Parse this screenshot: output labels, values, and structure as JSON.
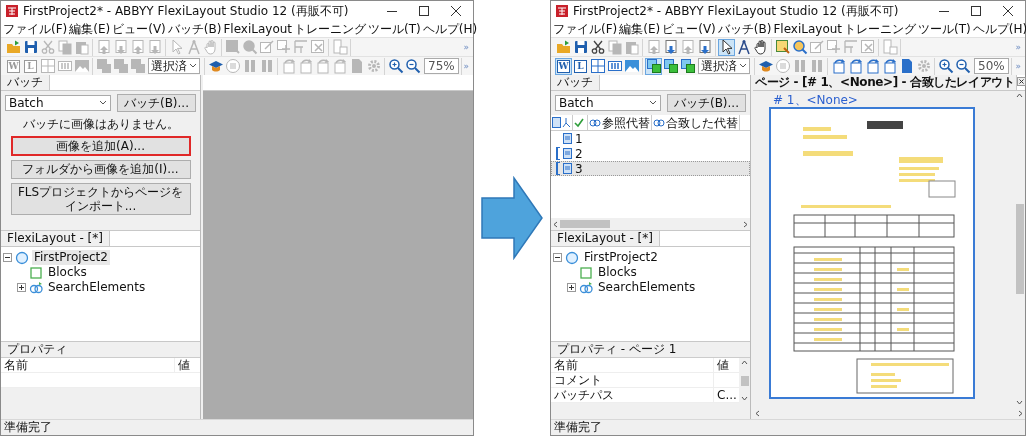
{
  "windows": [
    {
      "title": "FirstProject2* - ABBYY FlexiLayout Studio 12 (再販不可)",
      "menu": [
        "ファイル(F)",
        "編集(E)",
        "ビュー(V)",
        "バッチ(B)",
        "FlexiLayout",
        "トレーニング",
        "ツール(T)",
        "ヘルプ(H)"
      ],
      "toolbars": [
        {
          "groups": [
            [
              {
                "selected": false,
                "disabled": false
              },
              {
                "selected": false,
                "disabled": false
              },
              {
                "selected": false,
                "disabled": true
              },
              {
                "selected": false,
                "disabled": true
              },
              {
                "selected": false,
                "disabled": true
              }
            ],
            [
              {
                "selected": false,
                "disabled": true
              },
              {
                "selected": false,
                "disabled": true
              },
              {
                "selected": false,
                "disabled": true
              },
              {
                "selected": false,
                "disabled": true
              }
            ],
            [
              {
                "selected": false,
                "disabled": true
              },
              {
                "selected": false,
                "disabled": true
              },
              {
                "selected": false,
                "disabled": true
              }
            ],
            [
              {
                "selected": false,
                "disabled": true
              },
              {
                "selected": false,
                "disabled": true
              },
              {
                "selected": false,
                "disabled": true
              },
              {
                "selected": false,
                "disabled": true
              },
              {
                "selected": false,
                "disabled": true
              },
              {
                "selected": false,
                "disabled": true
              }
            ],
            [
              {
                "selected": false,
                "disabled": true
              }
            ]
          ],
          "overflow": "»"
        },
        {
          "groups": [
            [
              {
                "label": "W",
                "selected": false,
                "disabled": true
              },
              {
                "label": "L",
                "selected": false,
                "disabled": true
              },
              {
                "selected": false,
                "disabled": true
              },
              {
                "selected": false,
                "disabled": true
              },
              {
                "selected": false,
                "disabled": true
              }
            ],
            [
              {
                "selected": false,
                "disabled": true
              },
              {
                "selected": false,
                "disabled": true
              },
              {
                "selected": false,
                "disabled": true
              }
            ],
            [
              {
                "selected": false,
                "disabled": false
              },
              {
                "selected": false,
                "disabled": true
              },
              {
                "selected": false,
                "disabled": true
              },
              {
                "selected": false,
                "disabled": true
              }
            ],
            [
              {
                "selected": false,
                "disabled": true
              },
              {
                "selected": false,
                "disabled": true
              },
              {
                "selected": false,
                "disabled": true
              },
              {
                "selected": false,
                "disabled": true
              },
              {
                "selected": false,
                "disabled": true
              },
              {
                "selected": false,
                "disabled": true
              }
            ],
            [
              {
                "selected": false,
                "disabled": false
              },
              {
                "selected": false,
                "disabled": false
              }
            ]
          ],
          "overflow": "»"
        }
      ],
      "selection_filter": "選択済",
      "zoom": "75%",
      "batch": {
        "tab": "バッチ",
        "dropdown": "Batch",
        "button": "バッチ(B)...",
        "message": "バッチに画像はありません。",
        "actions": [
          {
            "label": "画像を追加(A)...",
            "highlighted": true
          },
          {
            "label": "フォルダから画像を追加(I)...",
            "highlighted": false
          },
          {
            "label": "FLSプロジェクトからページをインポート...",
            "highlighted": false
          }
        ]
      },
      "layout_tab": "FlexiLayout - [*]",
      "tree": [
        {
          "label": "FirstProject2",
          "kind": "project",
          "expanded": true,
          "selected": true,
          "children": [
            {
              "label": "Blocks",
              "kind": "blocks",
              "selected": false
            },
            {
              "label": "SearchElements",
              "kind": "search",
              "expanded": false,
              "selected": false
            }
          ]
        }
      ],
      "properties": {
        "title": "プロパティ",
        "columns": [
          "名前",
          "値"
        ]
      },
      "status": "準備完了"
    },
    {
      "title": "FirstProject2* - ABBYY FlexiLayout Studio 12 (再販不可)",
      "menu": [
        "ファイル(F)",
        "編集(E)",
        "ビュー(V)",
        "バッチ(B)",
        "FlexiLayout",
        "トレーニング",
        "ツール(T)",
        "ヘルプ(H)"
      ],
      "toolbars": [
        {
          "groups": [
            [
              {
                "selected": false,
                "disabled": false
              },
              {
                "selected": false,
                "disabled": false
              },
              {
                "selected": false,
                "disabled": false
              },
              {
                "selected": false,
                "disabled": true
              },
              {
                "selected": false,
                "disabled": true
              }
            ],
            [
              {
                "selected": false,
                "disabled": true
              },
              {
                "selected": false,
                "disabled": false
              },
              {
                "selected": false,
                "disabled": true
              },
              {
                "selected": false,
                "disabled": false
              }
            ],
            [
              {
                "selected": true,
                "disabled": false
              },
              {
                "selected": false,
                "disabled": false
              },
              {
                "selected": false,
                "disabled": false
              }
            ],
            [
              {
                "selected": false,
                "disabled": false
              },
              {
                "selected": false,
                "disabled": false
              },
              {
                "selected": false,
                "disabled": true
              },
              {
                "selected": false,
                "disabled": true
              },
              {
                "selected": false,
                "disabled": true
              },
              {
                "selected": false,
                "disabled": true
              }
            ],
            [
              {
                "selected": false,
                "disabled": true
              }
            ]
          ],
          "overflow": "»"
        },
        {
          "groups": [
            [
              {
                "label": "W",
                "selected": true,
                "disabled": false
              },
              {
                "label": "L",
                "selected": false,
                "disabled": false
              },
              {
                "selected": false,
                "disabled": false
              },
              {
                "selected": false,
                "disabled": false
              },
              {
                "selected": false,
                "disabled": false
              }
            ],
            [
              {
                "selected": true,
                "disabled": false
              },
              {
                "selected": false,
                "disabled": false
              },
              {
                "selected": false,
                "disabled": false
              }
            ],
            [
              {
                "selected": false,
                "disabled": false
              },
              {
                "selected": false,
                "disabled": true
              },
              {
                "selected": false,
                "disabled": true
              },
              {
                "selected": false,
                "disabled": true
              }
            ],
            [
              {
                "selected": false,
                "disabled": false
              },
              {
                "selected": false,
                "disabled": false
              },
              {
                "selected": false,
                "disabled": false
              },
              {
                "selected": false,
                "disabled": false
              },
              {
                "selected": false,
                "disabled": false
              },
              {
                "selected": false,
                "disabled": true
              }
            ],
            [
              {
                "selected": false,
                "disabled": false
              },
              {
                "selected": false,
                "disabled": false
              }
            ]
          ],
          "overflow": "»"
        }
      ],
      "selection_filter": "選択済",
      "zoom": "50%",
      "batch": {
        "tab": "バッチ",
        "dropdown": "Batch",
        "button": "バッチ(B)...",
        "columns": [
          "参照代替",
          "合致した代替"
        ],
        "pages": [
          {
            "label": "1",
            "selected": false,
            "grouped": false
          },
          {
            "label": "2",
            "selected": false,
            "grouped": true
          },
          {
            "label": "3",
            "selected": true,
            "grouped": true
          }
        ]
      },
      "document": {
        "tab": "ページ - [# 1、<None>] - 合致したレイアウト",
        "link": "# 1、<None>"
      },
      "layout_tab": "FlexiLayout - [*]",
      "tree": [
        {
          "label": "FirstProject2",
          "kind": "project",
          "expanded": true,
          "selected": false,
          "children": [
            {
              "label": "Blocks",
              "kind": "blocks",
              "selected": false
            },
            {
              "label": "SearchElements",
              "kind": "search",
              "expanded": false,
              "selected": false
            }
          ]
        }
      ],
      "properties": {
        "title": "プロパティ - ページ 1",
        "columns": [
          "名前",
          "値"
        ],
        "rows": [
          {
            "name": "コメント"
          },
          {
            "name": "バッチパス",
            "value": "C..."
          }
        ]
      },
      "status": "準備完了"
    }
  ]
}
